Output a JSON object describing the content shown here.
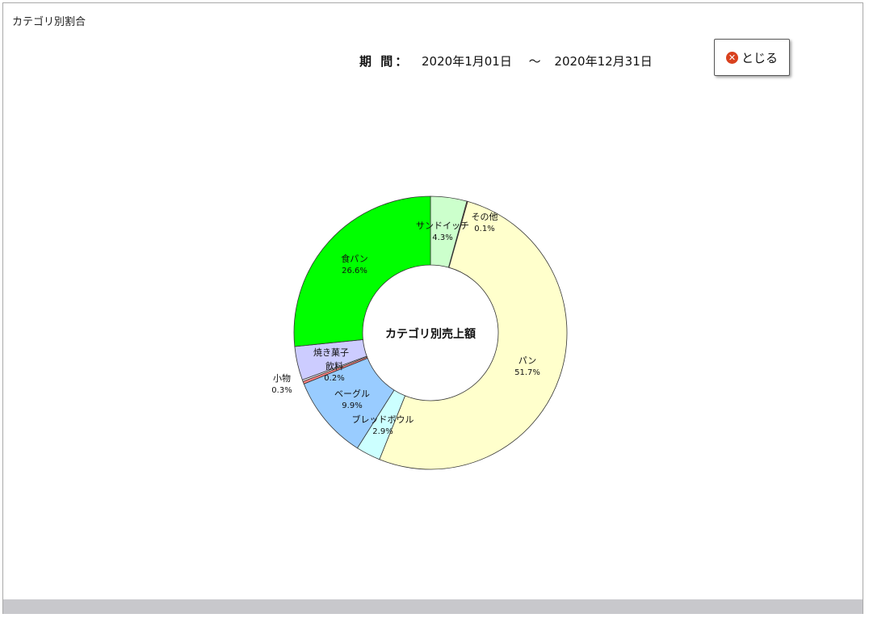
{
  "window": {
    "title": "カテゴリ別割合"
  },
  "period": {
    "label": "期 間：",
    "start": "2020年1月01日",
    "separator": "〜",
    "end": "2020年12月31日"
  },
  "close_button": {
    "label": "とじる",
    "icon": "close-circle-icon"
  },
  "chart_data": {
    "type": "pie",
    "style": "donut",
    "center_label": "カテゴリ別売上額",
    "slices": [
      {
        "name": "サンドイッチ",
        "label": "4.3%",
        "value": 4.3,
        "color": "#ccffcc"
      },
      {
        "name": "その他",
        "label": "0.1%",
        "value": 0.1,
        "color": "#c06040"
      },
      {
        "name": "パン",
        "label": "51.7%",
        "value": 51.7,
        "color": "#ffffcc"
      },
      {
        "name": "ブレッドボウル",
        "label": "2.9%",
        "value": 2.9,
        "color": "#ccffff"
      },
      {
        "name": "ベーグル",
        "label": "9.9%",
        "value": 9.9,
        "color": "#99ccff"
      },
      {
        "name": "小物",
        "label": "0.3%",
        "value": 0.3,
        "color": "#ff8080"
      },
      {
        "name": "飲料",
        "label": "0.2%",
        "value": 0.2,
        "color": "#ffffff"
      },
      {
        "name": "焼き菓子",
        "label": "",
        "value": 4.0,
        "color": "#ccccff"
      },
      {
        "name": "食パン",
        "label": "26.6%",
        "value": 26.6,
        "color": "#00ff00"
      }
    ]
  }
}
